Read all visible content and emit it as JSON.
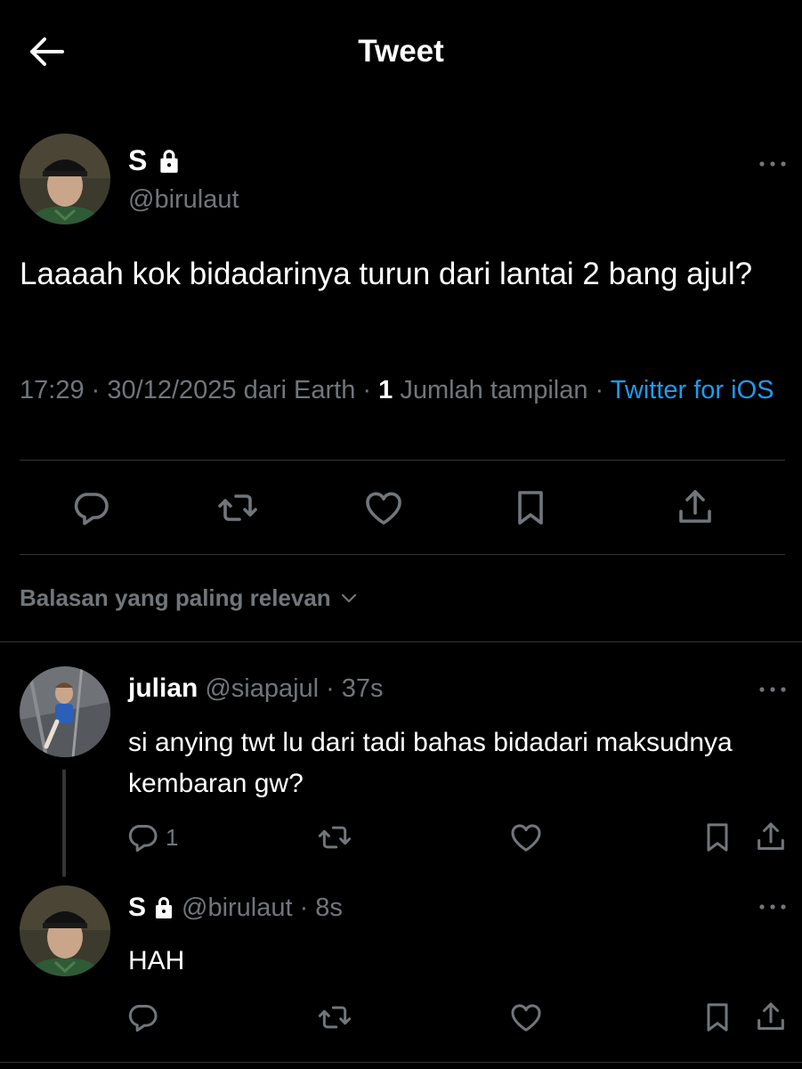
{
  "header": {
    "title": "Tweet"
  },
  "main_tweet": {
    "name": "S",
    "handle": "@birulaut",
    "text": "Laaaah kok bidadarinya turun dari lantai 2 bang ajul?",
    "time": "17:29",
    "date": "30/12/2025",
    "location": "dari Earth",
    "views_count": "1",
    "views_label": "Jumlah tampilan",
    "source": "Twitter for iOS",
    "separator": "·"
  },
  "sort": {
    "label": "Balasan yang paling relevan"
  },
  "replies": [
    {
      "name": "julian",
      "handle": "@siapajul",
      "time": "37s",
      "text": "si anying twt lu dari tadi bahas bidadari maksudnya kembaran gw?",
      "reply_count": "1"
    },
    {
      "name": "S",
      "handle": "@birulaut",
      "time": "8s",
      "text": "HAH"
    }
  ],
  "colors": {
    "background": "#000000",
    "muted": "#71767b",
    "link": "#1d9bf0",
    "divider": "#2f3336"
  }
}
